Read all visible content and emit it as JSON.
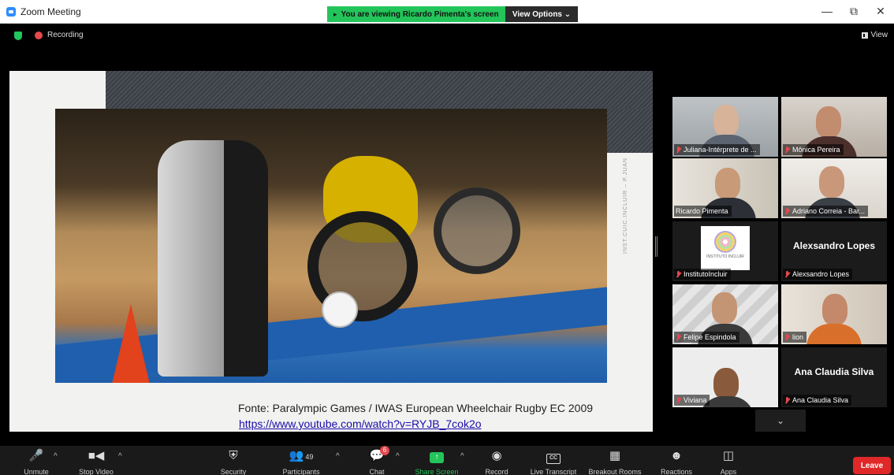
{
  "window": {
    "title": "Zoom Meeting",
    "viewing_banner": "You are viewing Ricardo Pimenta's screen",
    "view_options": "View Options ⌄",
    "minimize": "—",
    "restore": "⧉",
    "close": "✕"
  },
  "status": {
    "recording_label": "Recording",
    "view_label": "View"
  },
  "shared_screen": {
    "vertical_text": "INST.CUIC.INCLUIR – P.JUAN",
    "caption": "Fonte: Paralympic Games / IWAS European Wheelchair Rugby EC 2009",
    "link": "https://www.youtube.com/watch?v=RYJB_7cok2o"
  },
  "gallery": {
    "participants": [
      {
        "name": "Juliana-Intérprete de ...",
        "muted": true
      },
      {
        "name": "Mônica Pereira",
        "muted": true
      },
      {
        "name": "Ricardo Pimenta",
        "muted": false,
        "active": true
      },
      {
        "name": "Adriano Correia - Bar...",
        "muted": true
      },
      {
        "name": "InstitutoIncluir",
        "muted": true,
        "logo_text": "INSTITUTO INCLUIR"
      },
      {
        "name": "Alexsandro Lopes",
        "muted": true,
        "big_name": "Alexsandro Lopes"
      },
      {
        "name": "Felipe Espindola",
        "muted": true
      },
      {
        "name": "lion",
        "muted": true
      },
      {
        "name": "Viviana",
        "muted": true
      },
      {
        "name": "Ana Claudia Silva",
        "muted": true,
        "big_name": "Ana Claudia Silva"
      }
    ],
    "more_label": "⌄"
  },
  "toolbar": {
    "unmute": "Unmute",
    "stop_video": "Stop Video",
    "security": "Security",
    "participants": "Participants",
    "participants_count": "49",
    "chat": "Chat",
    "chat_badge": "6",
    "share_screen": "Share Screen",
    "record": "Record",
    "live_transcript": "Live Transcript",
    "breakout_rooms": "Breakout Rooms",
    "reactions": "Reactions",
    "apps": "Apps",
    "leave": "Leave"
  },
  "colors": {
    "accent": "#2d8cff",
    "banner_green": "#23c55a",
    "active_border": "#c9e05a",
    "leave_red": "#e02828"
  }
}
